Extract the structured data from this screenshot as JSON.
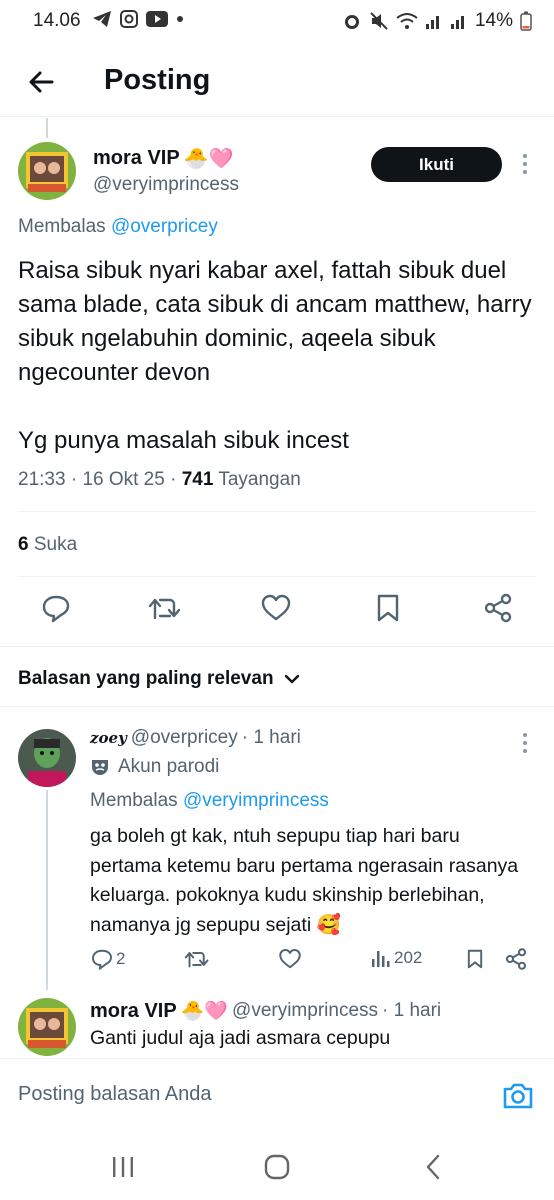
{
  "status_bar": {
    "time": "14.06",
    "battery": "14%"
  },
  "header": {
    "title": "Posting"
  },
  "post": {
    "author_name": "mora VIP",
    "author_emoji": "🐣🩷",
    "author_handle": "@veryimprincess",
    "follow_label": "Ikuti",
    "replying_prefix": "Membalas",
    "replying_to": "@overpricey",
    "body_p1": "Raisa sibuk nyari kabar axel, fattah sibuk duel sama blade, cata sibuk di ancam matthew, harry sibuk ngelabuhin dominic, aqeela sibuk ngecounter devon",
    "body_p2": "Yg punya masalah sibuk incest",
    "time": "21:33",
    "date": "16 Okt 25",
    "views_count": "741",
    "views_label": "Tayangan",
    "likes_count": "6",
    "likes_label": "Suka"
  },
  "sort_label": "Balasan yang paling relevan",
  "replies": [
    {
      "display_name": "zoey",
      "handle": "@overpricey",
      "age": "· 1 hari",
      "parody_label": "Akun parodi",
      "replying_prefix": "Membalas",
      "replying_to": "@veryimprincess",
      "body": "ga boleh gt kak, ntuh sepupu tiap hari baru pertama ketemu baru pertama ngerasain rasanya keluarga. pokoknya kudu skinship berlebihan, namanya jg sepupu sejati 🥰",
      "reply_count": "2",
      "views": "202"
    },
    {
      "display_name": "mora VIP",
      "emoji": "🐣🩷",
      "handle": "@veryimprincess",
      "age": "· 1 hari",
      "body": "Ganti judul aja jadi asmara cepupu"
    }
  ],
  "compose": {
    "placeholder": "Posting balasan Anda"
  },
  "icons": {
    "back": "arrow-left-icon",
    "reply": "reply-icon",
    "retweet": "repost-icon",
    "like": "heart-icon",
    "bookmark": "bookmark-icon",
    "share": "share-icon",
    "views": "views-icon",
    "camera": "camera-icon"
  },
  "colors": {
    "accent": "#1d9bf0",
    "text": "#0f1419",
    "muted": "#536471",
    "follow_bg": "#0f1419"
  }
}
